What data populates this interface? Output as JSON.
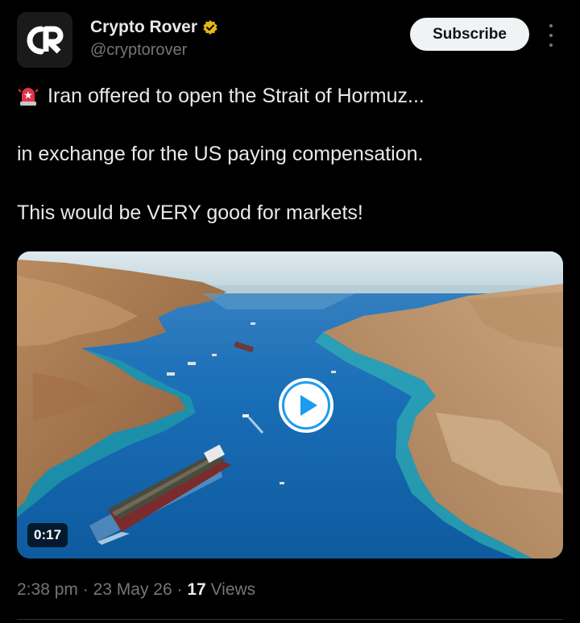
{
  "author": {
    "name": "Crypto Rover",
    "handle": "@cryptorover",
    "verified": true,
    "avatar_text": "CR"
  },
  "subscribe_label": "Subscribe",
  "tweet": {
    "emoji_icon": "police-light-icon",
    "line1": "Iran offered to open the Strait of Hormuz...",
    "line2": "in exchange for the US paying compensation.",
    "line3": "This would be VERY good for markets!"
  },
  "video": {
    "duration": "0:17",
    "scene": "aerial-strait-tanker"
  },
  "meta": {
    "time": "2:38 pm",
    "sep1": "·",
    "date": "23 May 26",
    "sep2": "·",
    "views_count": "17",
    "views_label": "Views"
  },
  "colors": {
    "background": "#000000",
    "text": "#e7e9ea",
    "muted": "#71767b",
    "verified_badge": "#e2b719",
    "play_button": "#1d9bf0"
  }
}
